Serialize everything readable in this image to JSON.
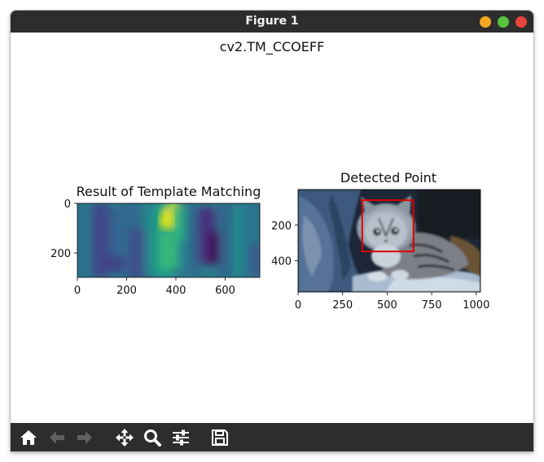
{
  "window": {
    "title": "Figure 1",
    "controls": {
      "minimize_color": "#f5a623",
      "maximize_color": "#58c33f",
      "close_color": "#e8453c"
    }
  },
  "figure": {
    "suptitle": "cv2.TM_CCOEFF"
  },
  "toolbar": {
    "icons": [
      "home-icon",
      "back-arrow-icon",
      "forward-arrow-icon",
      "pan-icon",
      "zoom-icon",
      "configure-subplots-icon",
      "save-icon"
    ],
    "icon_color": "#ffffff",
    "disabled_icon_color": "#5f5f5f"
  },
  "chart_data": [
    {
      "type": "heatmap",
      "title": "Result of Template Matching",
      "xlabel": "",
      "ylabel": "",
      "xlim": [
        0,
        740
      ],
      "ylim": [
        300,
        0
      ],
      "xticks": [
        "0",
        "200",
        "400",
        "600"
      ],
      "yticks": [
        "0",
        "200"
      ],
      "colormap": "viridis",
      "peak": {
        "x": 360,
        "y": 60
      }
    },
    {
      "type": "image",
      "title": "Detected Point",
      "xlabel": "",
      "ylabel": "",
      "xlim": [
        0,
        1024
      ],
      "ylim": [
        576,
        0
      ],
      "xticks": [
        "0",
        "250",
        "500",
        "750",
        "1000"
      ],
      "yticks": [
        "200",
        "400"
      ],
      "detected_box": {
        "x1": 360,
        "y1": 60,
        "x2": 648,
        "y2": 348,
        "color": "#e00000"
      }
    }
  ]
}
